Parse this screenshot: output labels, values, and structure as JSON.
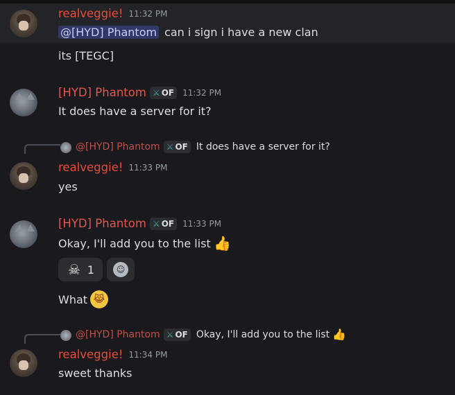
{
  "messages": [
    {
      "author": "realveggie!",
      "time": "11:32 PM",
      "mention": "@[HYD] Phantom",
      "text": "can i sign i have a new clan",
      "followup": "its [TEGC]"
    },
    {
      "author": "[HYD] Phantom",
      "tag": "OF",
      "time": "11:32 PM",
      "text": "It does have a server for it?"
    },
    {
      "reply_author": "@[HYD] Phantom",
      "reply_tag": "OF",
      "reply_text": "It does have a server for it?",
      "author": "realveggie!",
      "time": "11:33 PM",
      "text": "yes"
    },
    {
      "author": "[HYD] Phantom",
      "tag": "OF",
      "time": "11:33 PM",
      "text": "Okay, I'll add you to the list",
      "reaction_count": "1",
      "followup": "What"
    },
    {
      "reply_author": "@[HYD] Phantom",
      "reply_tag": "OF",
      "reply_text": "Okay, I'll add you to the list",
      "author": "realveggie!",
      "time": "11:34 PM",
      "text": "sweet thanks"
    }
  ],
  "icons": {
    "reaction_emoji": "skull-icon",
    "add_reaction": "add-reaction-icon",
    "tag_icon": "sword-icon"
  },
  "colors": {
    "background": "#1a1a1e",
    "username": "#e74c3c",
    "mention_bg": "#3c4270"
  }
}
